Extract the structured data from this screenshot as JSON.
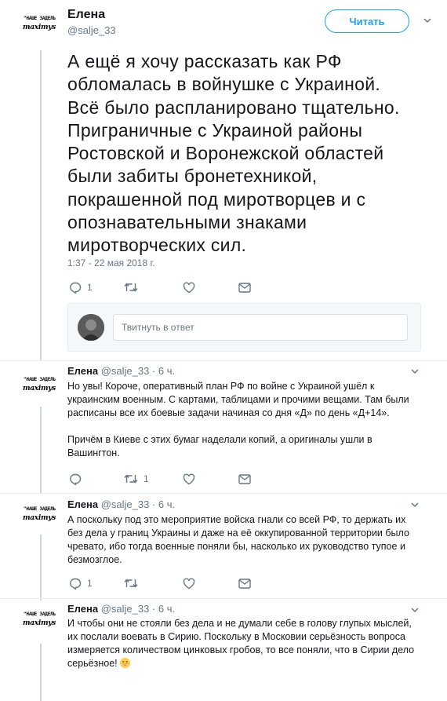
{
  "main_tweet": {
    "author_name": "Елена",
    "author_handle": "@salje_33",
    "avatar_text_top": "\"НАШЕ ЗАДЕЛЬ",
    "avatar_text_bottom": "maximys",
    "follow_label": "Читать",
    "text_lines": [
      "А ещё я хочу рассказать как РФ",
      "обломалась в войнушке с Украиной.",
      "Всё было распланировано тщательно.",
      "Приграничные с  Украиной районы",
      "Ростовской и Воронежской областей",
      "были забиты  бронетехникой,",
      "покрашенной под миротворцев и с",
      "опознавательными знаками",
      "миротворческих сил."
    ],
    "timestamp": "1:37 - 22 мая 2018 г.",
    "reply_count": "1",
    "retweet_count": "",
    "like_count": ""
  },
  "reply_box": {
    "placeholder": "Твитнуть в ответ"
  },
  "replies": [
    {
      "author_name": "Елена",
      "author_handle": "@salje_33",
      "time": "· 6 ч.",
      "avatar_text_top": "\"НАШЕ ЗАДЕЛЬ",
      "avatar_text_bottom": "maximys",
      "lines": [
        "Но увы! Короче, оперативный план РФ по войне с Украиной ушёл к",
        "украинским  военным.  С картами, таблицами и прочими вещами. Там были",
        "расписаны все  их боевые задачи начиная со дня «Д» по день «Д+14».",
        "",
        "Причём в Киеве с этих бумаг наделали копий, а оригиналы ушли в",
        "Вашингтон."
      ],
      "reply_count": "",
      "retweet_count": "1",
      "like_count": ""
    },
    {
      "author_name": "Елена",
      "author_handle": "@salje_33",
      "time": "· 6 ч.",
      "avatar_text_top": "\"НАШЕ ЗАДЕЛЬ",
      "avatar_text_bottom": "maximys",
      "lines": [
        "А поскольку под это мероприятие войска гнали со всей РФ, то держать их",
        "без дела у границ Украины и даже на её оккупированной территории было",
        "чревато, ибо тогда военные поняли бы, насколько их руководство тупое и",
        "безмозглое."
      ],
      "reply_count": "1",
      "retweet_count": "",
      "like_count": ""
    },
    {
      "author_name": "Елена",
      "author_handle": "@salje_33",
      "time": "· 6 ч.",
      "avatar_text_top": "\"НАШЕ ЗАДЕЛЬ",
      "avatar_text_bottom": "maximys",
      "lines": [
        "И чтобы они не стояли  без дела и не думали себе в голову глупых мыслей,",
        "их послали воевать в Сирию. Поскольку в Московии  серьёзность вопроса",
        "измеряется количеством цинковых гробов, то все поняли, что в Сирии дело",
        "серьёзное!"
      ]
    }
  ],
  "colors": {
    "accent": "#1da1f2",
    "secondary_text": "#657786",
    "divider": "#e6ecf0",
    "reply_box_bg": "#f5f8fa"
  },
  "icons": [
    "reply-icon",
    "retweet-icon",
    "like-icon",
    "message-icon",
    "chevron-down-icon",
    "grinning-emoji"
  ]
}
